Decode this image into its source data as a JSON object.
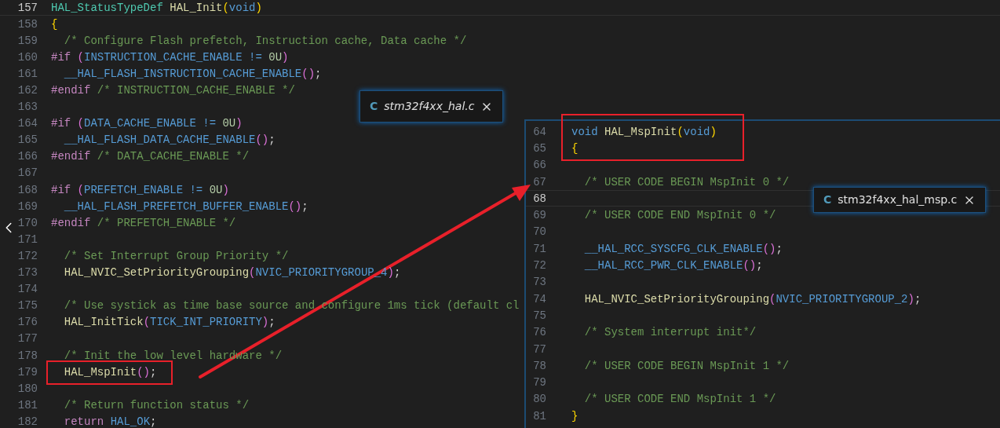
{
  "left_editor": {
    "lines": [
      {
        "number": "157",
        "current": true,
        "tokens": [
          {
            "t": "HAL_StatusTypeDef ",
            "kind": "type"
          },
          {
            "t": "HAL_Init",
            "kind": "func"
          },
          {
            "t": "(",
            "kind": "bracket1"
          },
          {
            "t": "void",
            "kind": "keyword"
          },
          {
            "t": ")",
            "kind": "bracket1"
          }
        ]
      },
      {
        "number": "158",
        "current": false,
        "tokens": [
          {
            "t": "{",
            "kind": "bracket1"
          }
        ]
      },
      {
        "number": "159",
        "current": false,
        "tokens": [
          {
            "t": "  /* Configure Flash prefetch, Instruction cache, Data cache */",
            "kind": "comment"
          }
        ]
      },
      {
        "number": "160",
        "current": false,
        "tokens": [
          {
            "t": "#if ",
            "kind": "pre"
          },
          {
            "t": "(",
            "kind": "bracket2"
          },
          {
            "t": "INSTRUCTION_CACHE_ENABLE != ",
            "kind": "macro"
          },
          {
            "t": "0U",
            "kind": "number"
          },
          {
            "t": ")",
            "kind": "bracket2"
          }
        ]
      },
      {
        "number": "161",
        "current": false,
        "tokens": [
          {
            "t": "  __HAL_FLASH_INSTRUCTION_CACHE_ENABLE",
            "kind": "macro"
          },
          {
            "t": "()",
            "kind": "bracket2"
          },
          {
            "t": ";",
            "kind": "plain"
          }
        ]
      },
      {
        "number": "162",
        "current": false,
        "tokens": [
          {
            "t": "#endif ",
            "kind": "pre"
          },
          {
            "t": "/* INSTRUCTION_CACHE_ENABLE */",
            "kind": "comment"
          }
        ]
      },
      {
        "number": "163",
        "current": false
      },
      {
        "number": "164",
        "current": false,
        "tokens": [
          {
            "t": "#if ",
            "kind": "pre"
          },
          {
            "t": "(",
            "kind": "bracket2"
          },
          {
            "t": "DATA_CACHE_ENABLE != ",
            "kind": "macro"
          },
          {
            "t": "0U",
            "kind": "number"
          },
          {
            "t": ")",
            "kind": "bracket2"
          }
        ]
      },
      {
        "number": "165",
        "current": false,
        "tokens": [
          {
            "t": "  __HAL_FLASH_DATA_CACHE_ENABLE",
            "kind": "macro"
          },
          {
            "t": "()",
            "kind": "bracket2"
          },
          {
            "t": ";",
            "kind": "plain"
          }
        ]
      },
      {
        "number": "166",
        "current": false,
        "tokens": [
          {
            "t": "#endif ",
            "kind": "pre"
          },
          {
            "t": "/* DATA_CACHE_ENABLE */",
            "kind": "comment"
          }
        ]
      },
      {
        "number": "167",
        "current": false
      },
      {
        "number": "168",
        "current": false,
        "tokens": [
          {
            "t": "#if ",
            "kind": "pre"
          },
          {
            "t": "(",
            "kind": "bracket2"
          },
          {
            "t": "PREFETCH_ENABLE != ",
            "kind": "macro"
          },
          {
            "t": "0U",
            "kind": "number"
          },
          {
            "t": ")",
            "kind": "bracket2"
          }
        ]
      },
      {
        "number": "169",
        "current": false,
        "tokens": [
          {
            "t": "  __HAL_FLASH_PREFETCH_BUFFER_ENABLE",
            "kind": "macro"
          },
          {
            "t": "()",
            "kind": "bracket2"
          },
          {
            "t": ";",
            "kind": "plain"
          }
        ]
      },
      {
        "number": "170",
        "current": false,
        "tokens": [
          {
            "t": "#endif ",
            "kind": "pre"
          },
          {
            "t": "/* PREFETCH_ENABLE */",
            "kind": "comment"
          }
        ]
      },
      {
        "number": "171",
        "current": false
      },
      {
        "number": "172",
        "current": false,
        "tokens": [
          {
            "t": "  /* Set Interrupt Group Priority */",
            "kind": "comment"
          }
        ]
      },
      {
        "number": "173",
        "current": false,
        "tokens": [
          {
            "t": "  HAL_NVIC_SetPriorityGrouping",
            "kind": "func"
          },
          {
            "t": "(",
            "kind": "bracket2"
          },
          {
            "t": "NVIC_PRIORITYGROUP_4",
            "kind": "macro"
          },
          {
            "t": ")",
            "kind": "bracket2"
          },
          {
            "t": ";",
            "kind": "plain"
          }
        ]
      },
      {
        "number": "174",
        "current": false
      },
      {
        "number": "175",
        "current": false,
        "tokens": [
          {
            "t": "  /* Use systick as time base source and configure 1ms tick (default cl",
            "kind": "comment"
          }
        ]
      },
      {
        "number": "176",
        "current": false,
        "tokens": [
          {
            "t": "  HAL_InitTick",
            "kind": "func"
          },
          {
            "t": "(",
            "kind": "bracket2"
          },
          {
            "t": "TICK_INT_PRIORITY",
            "kind": "macro"
          },
          {
            "t": ")",
            "kind": "bracket2"
          },
          {
            "t": ";",
            "kind": "plain"
          }
        ]
      },
      {
        "number": "177",
        "current": false
      },
      {
        "number": "178",
        "current": false,
        "tokens": [
          {
            "t": "  /* Init the low level hardware */",
            "kind": "comment"
          }
        ]
      },
      {
        "number": "179",
        "current": false,
        "tokens": [
          {
            "t": "  HAL_MspInit",
            "kind": "func"
          },
          {
            "t": "()",
            "kind": "bracket2"
          },
          {
            "t": ";",
            "kind": "plain"
          }
        ]
      },
      {
        "number": "180",
        "current": false
      },
      {
        "number": "181",
        "current": false,
        "tokens": [
          {
            "t": "  /* Return function status */",
            "kind": "comment"
          }
        ]
      },
      {
        "number": "182",
        "current": false,
        "tokens": [
          {
            "t": "  return ",
            "kind": "pre"
          },
          {
            "t": "HAL_OK",
            "kind": "macro"
          },
          {
            "t": ";",
            "kind": "plain"
          }
        ]
      }
    ]
  },
  "right_editor": {
    "lines": [
      {
        "number": "64",
        "current": false,
        "tokens": [
          {
            "t": "void ",
            "kind": "keyword"
          },
          {
            "t": "HAL_MspInit",
            "kind": "func"
          },
          {
            "t": "(",
            "kind": "bracket1"
          },
          {
            "t": "void",
            "kind": "keyword"
          },
          {
            "t": ")",
            "kind": "bracket1"
          }
        ]
      },
      {
        "number": "65",
        "current": false,
        "tokens": [
          {
            "t": "{",
            "kind": "bracket1"
          }
        ]
      },
      {
        "number": "66",
        "current": false
      },
      {
        "number": "67",
        "current": false,
        "tokens": [
          {
            "t": "  /* USER CODE BEGIN MspInit 0 */",
            "kind": "comment"
          }
        ]
      },
      {
        "number": "68",
        "current": true
      },
      {
        "number": "69",
        "current": false,
        "tokens": [
          {
            "t": "  /* USER CODE END MspInit 0 */",
            "kind": "comment"
          }
        ]
      },
      {
        "number": "70",
        "current": false
      },
      {
        "number": "71",
        "current": false,
        "tokens": [
          {
            "t": "  __HAL_RCC_SYSCFG_CLK_ENABLE",
            "kind": "macro"
          },
          {
            "t": "()",
            "kind": "bracket2"
          },
          {
            "t": ";",
            "kind": "plain"
          }
        ]
      },
      {
        "number": "72",
        "current": false,
        "tokens": [
          {
            "t": "  __HAL_RCC_PWR_CLK_ENABLE",
            "kind": "macro"
          },
          {
            "t": "()",
            "kind": "bracket2"
          },
          {
            "t": ";",
            "kind": "plain"
          }
        ]
      },
      {
        "number": "73",
        "current": false
      },
      {
        "number": "74",
        "current": false,
        "tokens": [
          {
            "t": "  HAL_NVIC_SetPriorityGrouping",
            "kind": "func"
          },
          {
            "t": "(",
            "kind": "bracket2"
          },
          {
            "t": "NVIC_PRIORITYGROUP_2",
            "kind": "macro"
          },
          {
            "t": ")",
            "kind": "bracket2"
          },
          {
            "t": ";",
            "kind": "plain"
          }
        ]
      },
      {
        "number": "75",
        "current": false
      },
      {
        "number": "76",
        "current": false,
        "tokens": [
          {
            "t": "  /* System interrupt init*/",
            "kind": "comment"
          }
        ]
      },
      {
        "number": "77",
        "current": false
      },
      {
        "number": "78",
        "current": false,
        "tokens": [
          {
            "t": "  /* USER CODE BEGIN MspInit 1 */",
            "kind": "comment"
          }
        ]
      },
      {
        "number": "79",
        "current": false
      },
      {
        "number": "80",
        "current": false,
        "tokens": [
          {
            "t": "  /* USER CODE END MspInit 1 */",
            "kind": "comment"
          }
        ]
      },
      {
        "number": "81",
        "current": false,
        "tokens": [
          {
            "t": "}",
            "kind": "bracket1"
          }
        ]
      }
    ]
  },
  "file_tabs": [
    {
      "icon_text": "C",
      "name": "stm32f4xx_hal.c",
      "preview": true
    },
    {
      "icon_text": "C",
      "name": "stm32f4xx_hal_msp.c",
      "preview": false
    }
  ]
}
